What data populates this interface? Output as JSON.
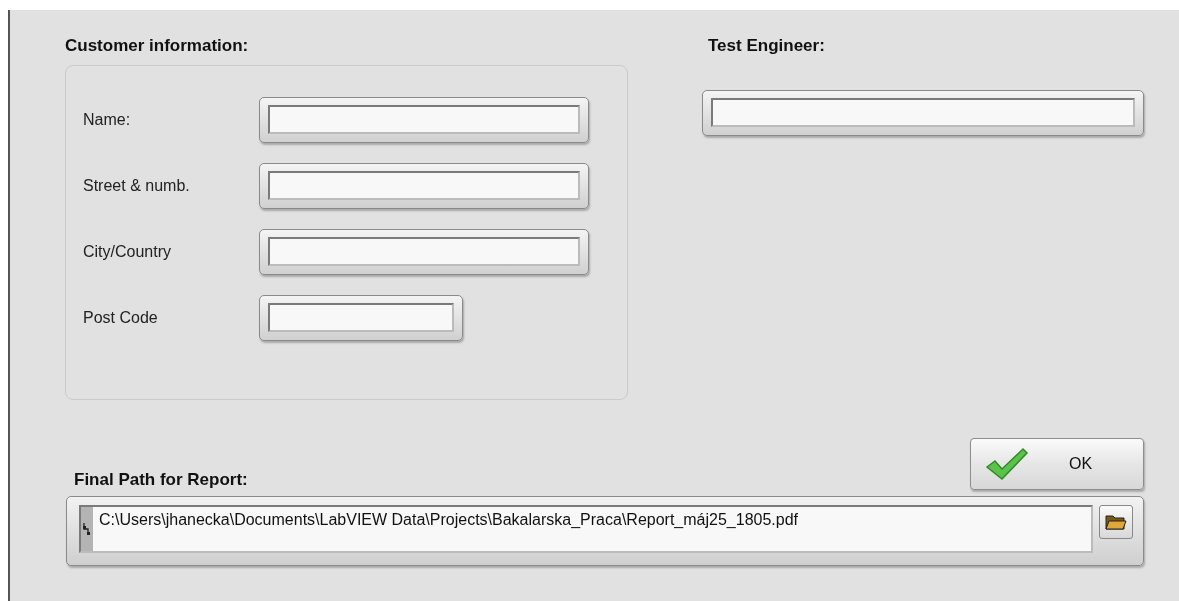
{
  "customer_information": {
    "heading": "Customer information:",
    "fields": [
      {
        "label": "Name:",
        "kind": "text"
      },
      {
        "label": "Street & numb.",
        "kind": "text"
      },
      {
        "label": "City/Country",
        "kind": "text"
      },
      {
        "label": "Post Code",
        "kind": "short"
      }
    ]
  },
  "test_engineer": {
    "heading": "Test Engineer:"
  },
  "ok_button": {
    "label": "OK"
  },
  "report_path": {
    "heading": "Final Path for Report:",
    "value": "C:\\Users\\jhanecka\\Documents\\LabVIEW Data\\Projects\\Bakalarska_Praca\\Report_máj25_1805.pdf"
  }
}
